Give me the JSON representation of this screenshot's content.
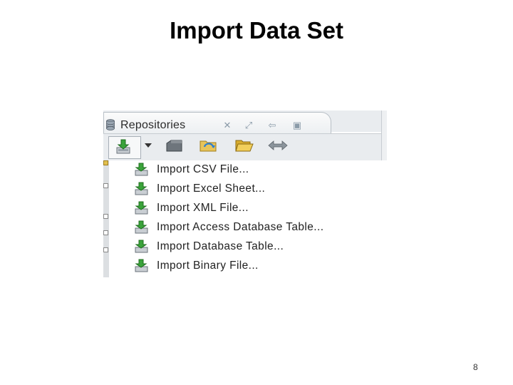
{
  "slide": {
    "title": "Import Data Set",
    "page_number": "8"
  },
  "panel": {
    "tab_label": "Repositories",
    "tab_icon": "database-icon",
    "tab_tools": [
      "close-icon",
      "maximize-icon",
      "minimize-icon",
      "restore-icon"
    ]
  },
  "toolbar": {
    "buttons": [
      "import-data-icon",
      "dropdown-arrow-icon",
      "repository-icon",
      "folder-refresh-icon",
      "open-folder-icon",
      "move-arrows-icon"
    ]
  },
  "menu": {
    "items": [
      {
        "label": "Import CSV File..."
      },
      {
        "label": "Import Excel Sheet..."
      },
      {
        "label": "Import XML File..."
      },
      {
        "label": "Import Access Database Table..."
      },
      {
        "label": "Import Database Table..."
      },
      {
        "label": "Import Binary File..."
      }
    ]
  },
  "colors": {
    "accent_green": "#3aa33a",
    "panel_bg": "#e9ecef"
  }
}
